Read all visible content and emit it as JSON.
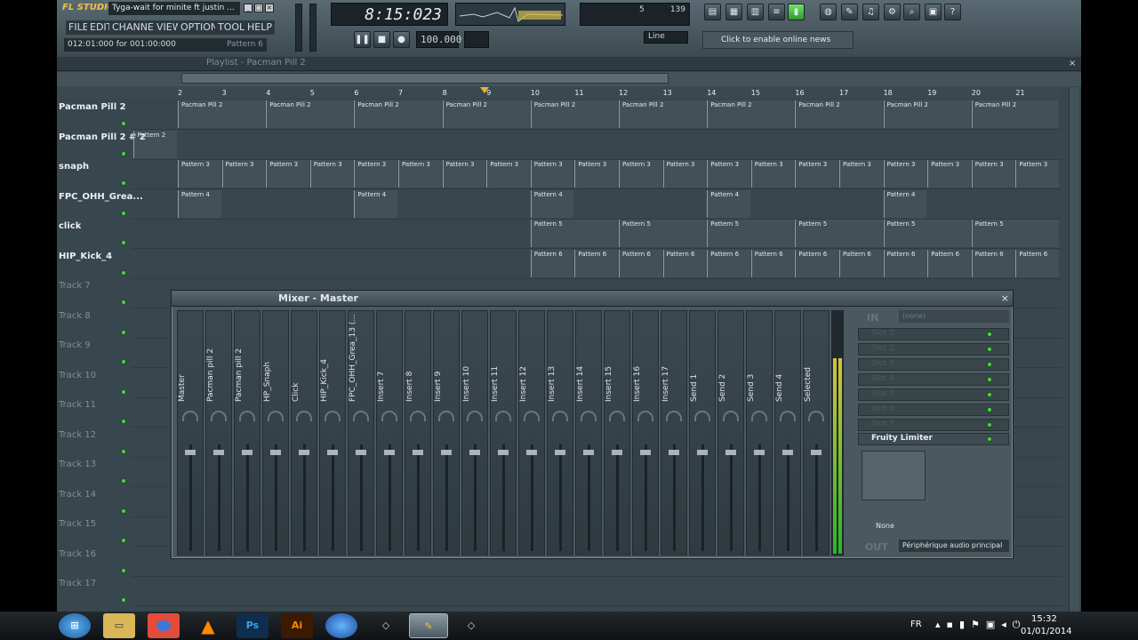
{
  "titlebar": {
    "logo": "FL STUDIO",
    "song": "Tyga-wait for minite ft justin ..."
  },
  "menu": [
    "FILE",
    "EDIT",
    "CHANNELS",
    "VIEW",
    "OPTIONS",
    "TOOLS",
    "HELP"
  ],
  "hint": {
    "position": "012:01:000 for 001:00:000",
    "pattern": "Pattern 6"
  },
  "time": "8:15:023",
  "tempo": "100.000",
  "cpu": "5",
  "poly": "139",
  "snap": "Line",
  "online_news": "Click to enable online news",
  "playlist": {
    "title": "Playlist - Pacman Pill 2"
  },
  "ruler": [
    "2",
    "3",
    "4",
    "5",
    "6",
    "7",
    "8",
    "9",
    "10",
    "11",
    "12",
    "13",
    "14",
    "15",
    "16",
    "17",
    "18",
    "19",
    "20",
    "21"
  ],
  "tracks": [
    {
      "name": "Pacman Pill 2",
      "dim": false
    },
    {
      "name": "Pacman Pill 2 # 2",
      "dim": false
    },
    {
      "name": "snaph",
      "dim": false
    },
    {
      "name": "FPC_OHH_Grea...",
      "dim": false
    },
    {
      "name": "click",
      "dim": false
    },
    {
      "name": "HIP_Kick_4",
      "dim": false
    },
    {
      "name": "Track 7",
      "dim": true
    },
    {
      "name": "Track 8",
      "dim": true
    },
    {
      "name": "Track 9",
      "dim": true
    },
    {
      "name": "Track 10",
      "dim": true
    },
    {
      "name": "Track 11",
      "dim": true
    },
    {
      "name": "Track 12",
      "dim": true
    },
    {
      "name": "Track 13",
      "dim": true
    },
    {
      "name": "Track 14",
      "dim": true
    },
    {
      "name": "Track 15",
      "dim": true
    },
    {
      "name": "Track 16",
      "dim": true
    },
    {
      "name": "Track 17",
      "dim": true
    }
  ],
  "patterns": {
    "p1": "Pacman Pill 2",
    "p1b": "Pattern 2",
    "p3": "Pattern 3",
    "p4": "Pattern 4",
    "p5": "Pattern 5",
    "p6": "Pattern 6"
  },
  "mixer": {
    "title": "Mixer - Master",
    "strips": [
      "Master",
      "Pacman pill 2",
      "Pacman pill 2",
      "HP_Snaph",
      "Click",
      "HIP_Kick_4",
      "FPC_OHH_Grea_13 (...",
      "Insert 7",
      "Insert 8",
      "Insert 9",
      "Insert 10",
      "Insert 11",
      "Insert 12",
      "Insert 13",
      "Insert 14",
      "Insert 15",
      "Insert 16",
      "Insert 17",
      "Send 1",
      "Send 2",
      "Send 3",
      "Send 4",
      "Selected"
    ],
    "in_label": "IN",
    "in_value": "(none)",
    "slots": [
      "Slot 1",
      "Slot 2",
      "Slot 3",
      "Slot 4",
      "Slot 5",
      "Slot 6",
      "Slot 7"
    ],
    "limiter": "Fruity Limiter",
    "preset": "None",
    "out_label": "OUT",
    "output": "Périphérique audio principal"
  },
  "taskbar": {
    "lang": "FR",
    "time": "15:32",
    "date": "01/01/2014"
  }
}
